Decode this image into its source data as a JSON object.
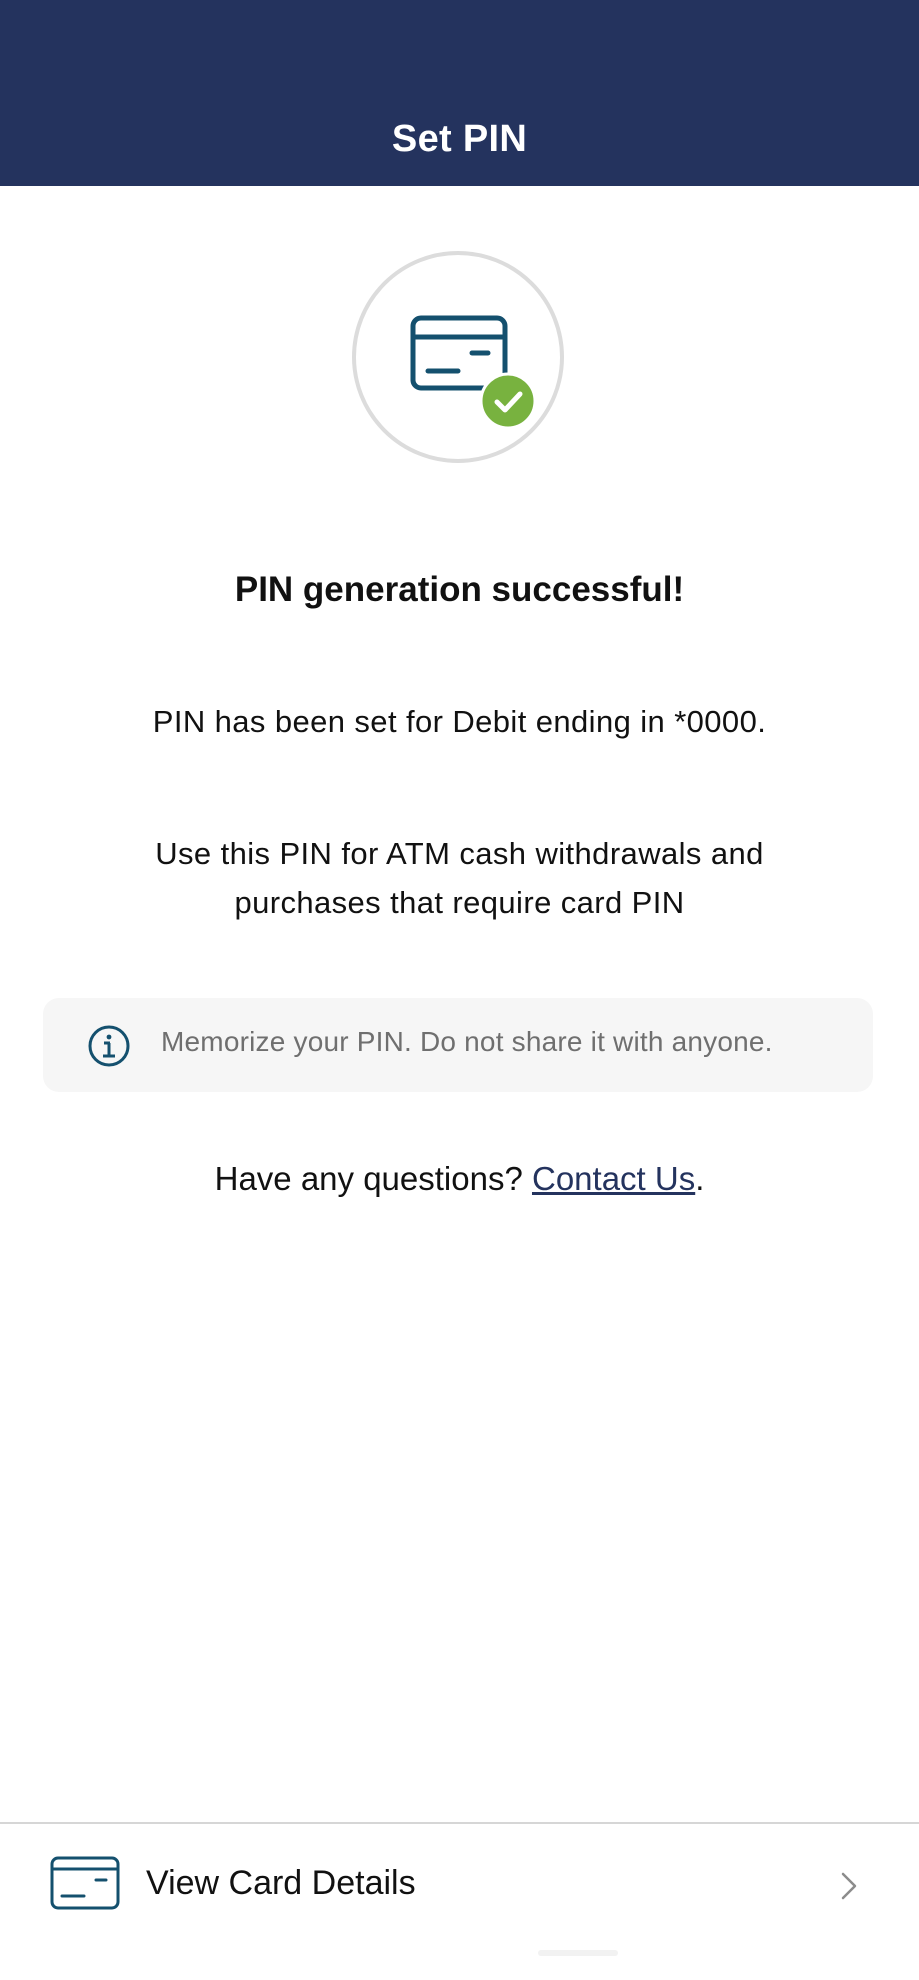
{
  "header": {
    "title": "Set PIN",
    "background_color": "#24335e"
  },
  "hero": {
    "card_icon": "credit-card-icon",
    "check_icon": "check-circle-icon",
    "card_color": "#14506e",
    "check_color": "#78b23f"
  },
  "status": {
    "title": "PIN generation successful!",
    "pin_set_text": "PIN has been set for Debit ending in *0000.",
    "usage_line_1": "Use this PIN for ATM cash withdrawals and",
    "usage_line_2": "purchases that require card PIN"
  },
  "notice": {
    "icon": "info-icon",
    "text": "Memorize your PIN. Do not share it with anyone."
  },
  "help": {
    "prefix": "Have any questions?",
    "link_label": "Contact Us",
    "suffix": "."
  },
  "footer": {
    "icon": "credit-card-icon",
    "label": "View Card Details",
    "chevron_icon": "chevron-right-icon"
  }
}
